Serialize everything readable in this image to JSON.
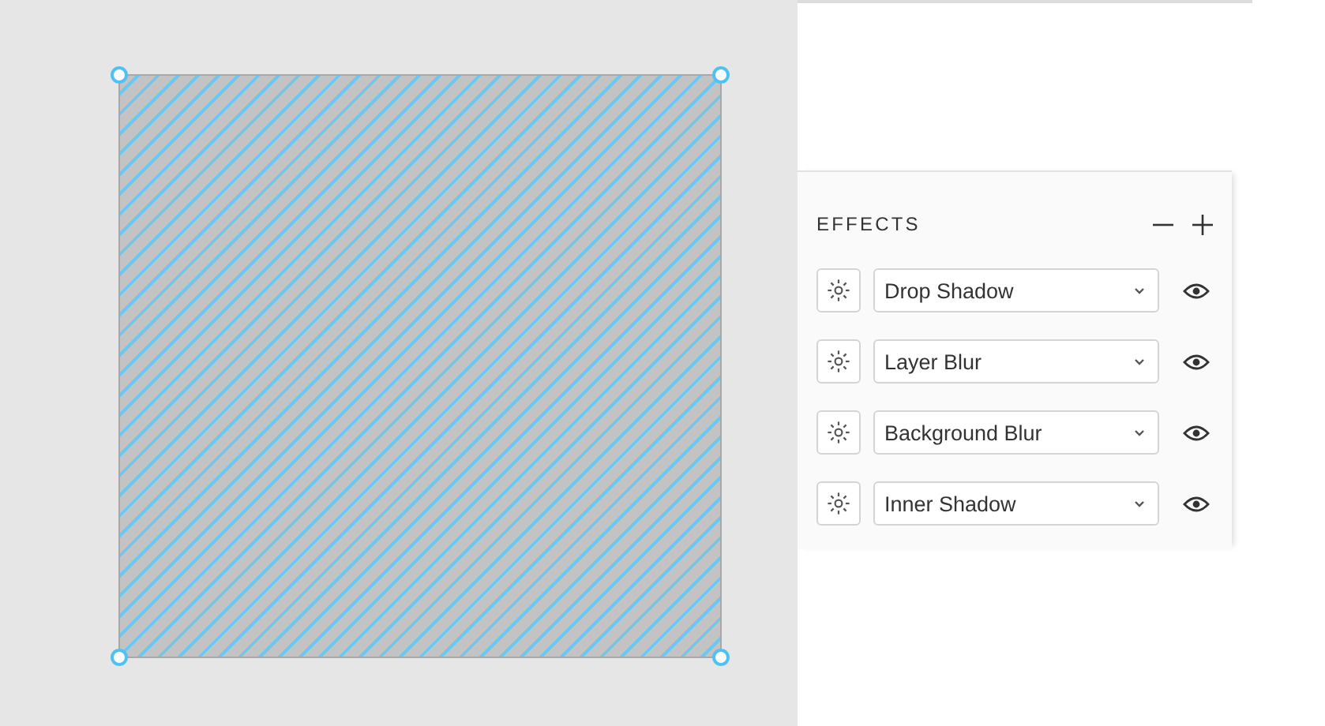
{
  "canvas": {
    "shape": {
      "selected": true
    }
  },
  "effects_panel": {
    "title": "EFFECTS",
    "effects": [
      {
        "label": "Drop Shadow"
      },
      {
        "label": "Layer Blur"
      },
      {
        "label": "Background Blur"
      },
      {
        "label": "Inner Shadow"
      }
    ]
  }
}
